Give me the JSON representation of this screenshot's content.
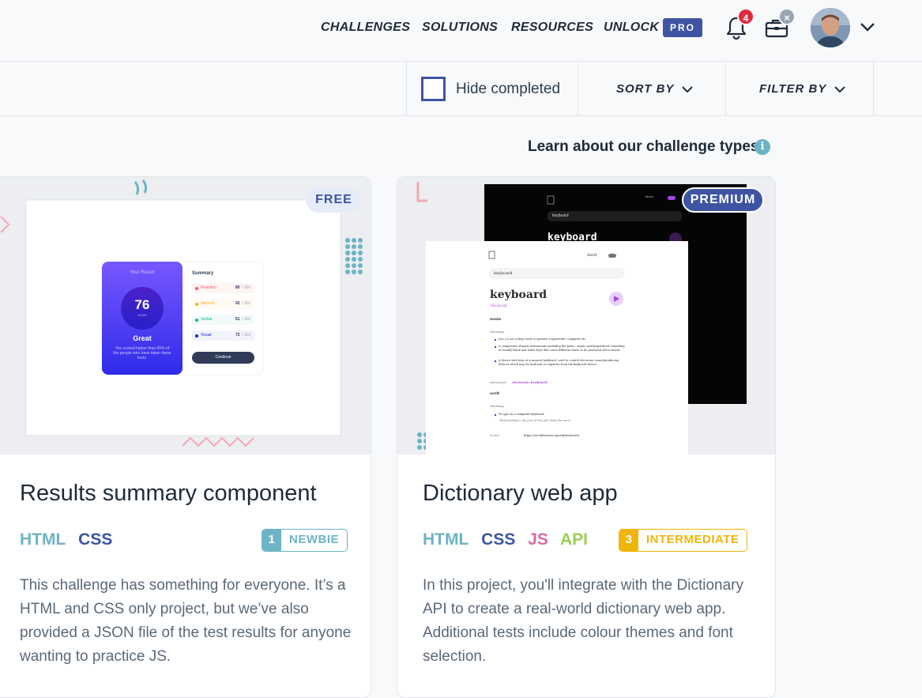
{
  "nav": {
    "links": [
      "CHALLENGES",
      "SOLUTIONS",
      "RESOURCES",
      "UNLOCK"
    ],
    "pro_label": "PRO",
    "notification_count": "4",
    "briefcase_badge": "×",
    "icons": [
      "bell-icon",
      "briefcase-icon",
      "avatar",
      "chevron-down-icon"
    ]
  },
  "filters": {
    "hide_completed_label": "Hide completed",
    "sort_label": "SORT BY",
    "filter_label": "FILTER BY"
  },
  "learn": {
    "text": "Learn about our challenge types",
    "icon": "i"
  },
  "cards": [
    {
      "badge": "FREE",
      "title": "Results summary component",
      "tags": [
        "HTML",
        "CSS"
      ],
      "level_number": "1",
      "level_label": "NEWBIE",
      "description": "This challenge has something for everyone. It’s a HTML and CSS only project, but we’ve also provided a JSON file of the test results for anyone wanting to practice JS.",
      "preview": {
        "result_heading": "Your Result",
        "score": "76",
        "score_of": "of 100",
        "grade": "Great",
        "result_text": "You scored higher than 65% of the people who have taken these tests.",
        "summary_heading": "Summary",
        "summary_items": [
          {
            "label": "Reaction",
            "score": "80",
            "total": "/ 100"
          },
          {
            "label": "Memory",
            "score": "92",
            "total": "/ 100"
          },
          {
            "label": "Verbal",
            "score": "61",
            "total": "/ 100"
          },
          {
            "label": "Visual",
            "score": "72",
            "total": "/ 100"
          }
        ],
        "button": "Continue"
      }
    },
    {
      "badge": "PREMIUM",
      "title": "Dictionary web app",
      "tags": [
        "HTML",
        "CSS",
        "JS",
        "API"
      ],
      "level_number": "3",
      "level_label": "INTERMEDIATE",
      "description": "In this project, you'll integrate with the Dictionary API to create a real-world dictionary web app. Additional tests include colour themes and font selection.",
      "preview": {
        "search_term": "keyboard",
        "word": "keyboard",
        "phonetic": "/ˈkiːbɔːd/",
        "font_select": "Serif",
        "dark_font_select": "Mono",
        "pos_noun": "noun",
        "meaning_label": "Meaning",
        "meanings": [
          "(etc.) A set of keys used to operate a typewriter, computer etc.",
          "A component of many instruments including the piano, organ, and harpsichord consisting of usually black and white keys that cause different tones to be produced when struck.",
          "A device with keys of a musical keyboard, used to control electronic sound-producing devices which may be built into or separate from the keyboard device."
        ],
        "synonyms_label": "Synonyms",
        "synonym": "electronic keyboard",
        "pos_verb": "verb",
        "verb_meaning": "To type on a computer keyboard.",
        "verb_example": "“Keyboarding is the part of this job I hate the most.”",
        "source_label": "Source",
        "source_url": "https://en.wiktionary.org/wiki/keyboard"
      }
    }
  ],
  "colors": {
    "accent": "#3e54a3",
    "html_tag": "#6cb4c6",
    "css_tag": "#3e54a3",
    "js_tag": "#d66ba6",
    "api_tag": "#9bcf53",
    "newbie": "#6cb4c6",
    "intermediate": "#f0b50a",
    "notification": "#e02a3c"
  }
}
